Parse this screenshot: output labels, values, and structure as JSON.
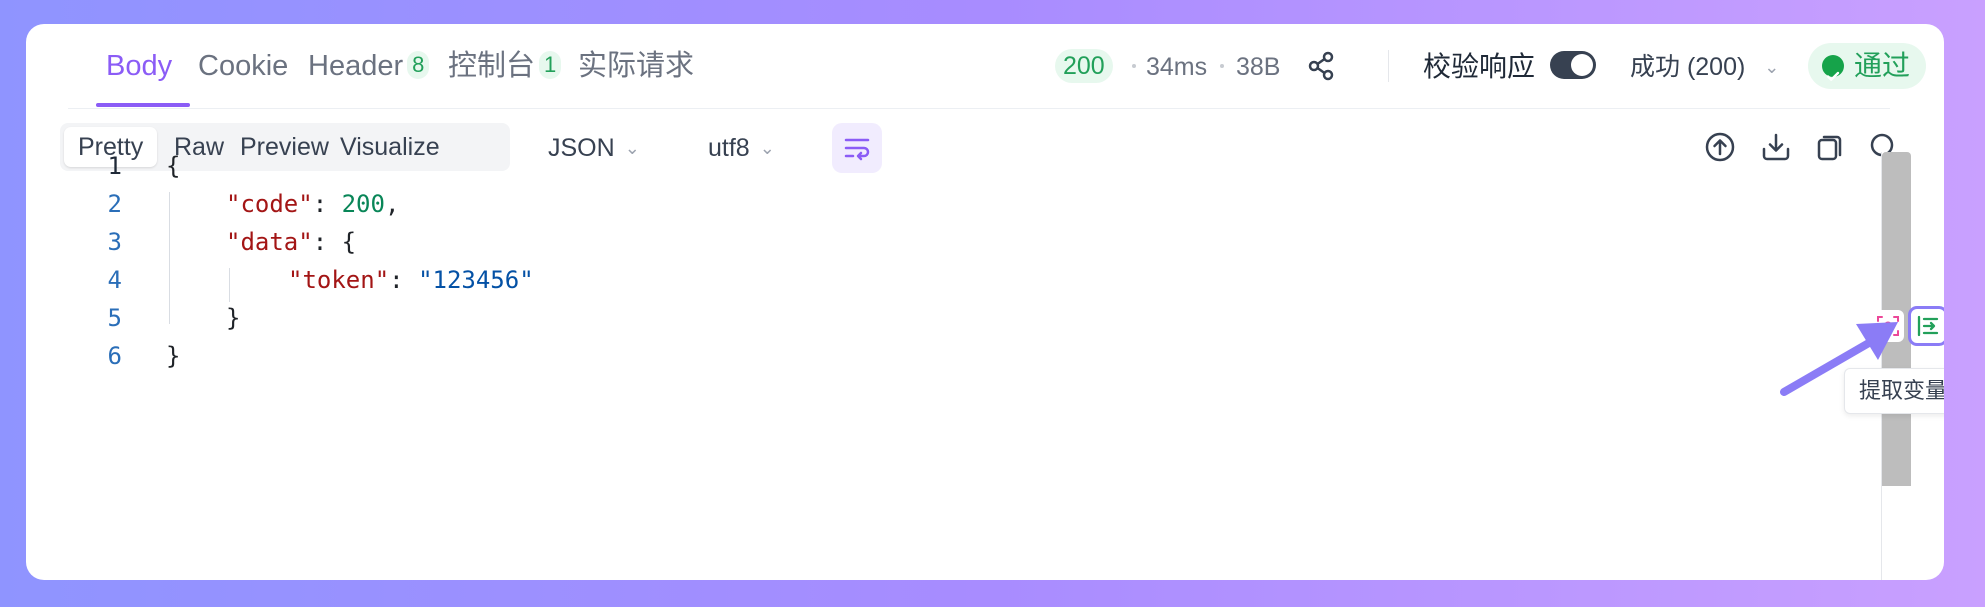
{
  "tabs": [
    {
      "label": "Body"
    },
    {
      "label": "Cookie"
    },
    {
      "label": "Header",
      "count": "8"
    },
    {
      "label": "控制台",
      "count": "1"
    },
    {
      "label": "实际请求"
    }
  ],
  "response_meta": {
    "status": "200",
    "time": "34ms",
    "size": "38B"
  },
  "validate": {
    "label": "校验响应",
    "enabled": true,
    "select_value": "成功 (200)",
    "result": "通过"
  },
  "view_modes": [
    "Pretty",
    "Raw",
    "Preview",
    "Visualize"
  ],
  "format_select": "JSON",
  "encoding_select": "utf8",
  "code": {
    "line_numbers": [
      "1",
      "2",
      "3",
      "4",
      "5",
      "6"
    ],
    "keys": {
      "code": "\"code\"",
      "data": "\"data\"",
      "token": "\"token\""
    },
    "values": {
      "code": "200",
      "token": "\"123456\""
    }
  },
  "tooltip": "提取变量",
  "colors": {
    "accent": "#8b5cf6",
    "success": "#22a05a",
    "key": "#a31515",
    "number": "#098658",
    "string": "#0451a5"
  }
}
